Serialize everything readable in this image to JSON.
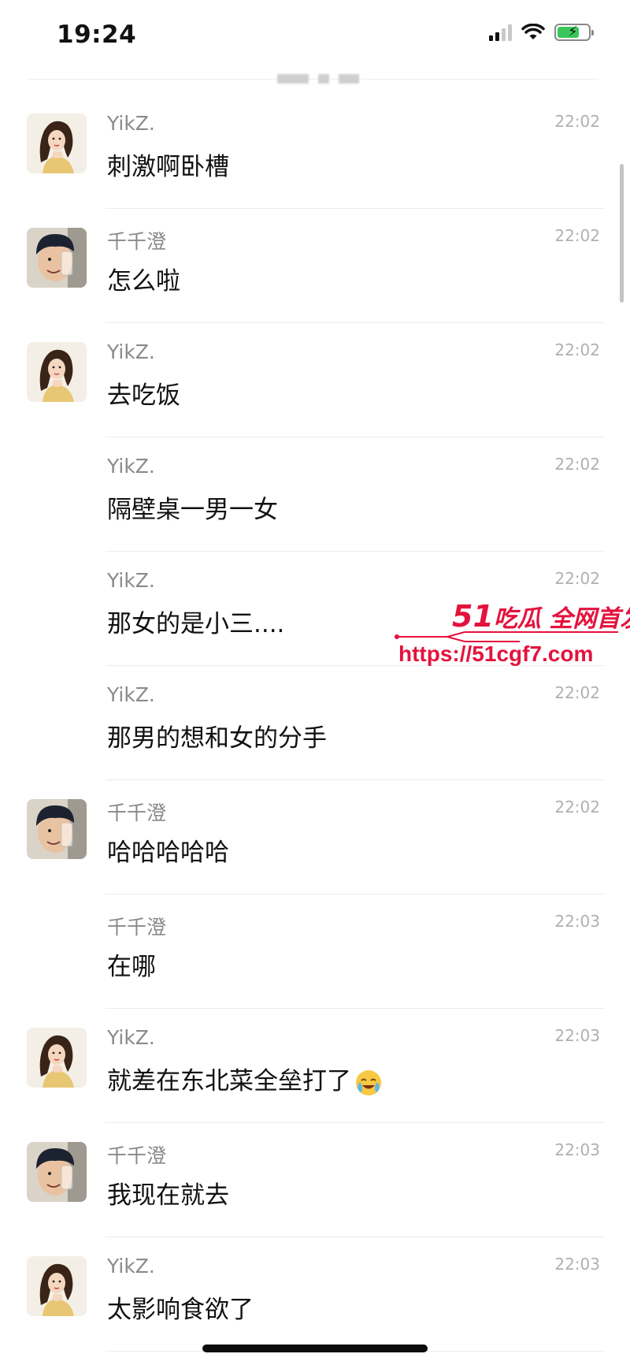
{
  "status_bar": {
    "time": "19:24",
    "battery_level": 0.7
  },
  "messages": [
    {
      "sender": "YikZ.",
      "avatar": "belle-avatar",
      "show_avatar": true,
      "time": "22:02",
      "text": "刺激啊卧槽"
    },
    {
      "sender": "千千澄",
      "avatar": "man-avatar",
      "show_avatar": true,
      "time": "22:02",
      "text": "怎么啦"
    },
    {
      "sender": "YikZ.",
      "avatar": "belle-avatar",
      "show_avatar": true,
      "time": "22:02",
      "text": "去吃饭"
    },
    {
      "sender": "YikZ.",
      "avatar": "belle-avatar",
      "show_avatar": false,
      "time": "22:02",
      "text": "隔壁桌一男一女"
    },
    {
      "sender": "YikZ.",
      "avatar": "belle-avatar",
      "show_avatar": false,
      "time": "22:02",
      "text": "那女的是小三...."
    },
    {
      "sender": "YikZ.",
      "avatar": "belle-avatar",
      "show_avatar": false,
      "time": "22:02",
      "text": "那男的想和女的分手"
    },
    {
      "sender": "千千澄",
      "avatar": "man-avatar",
      "show_avatar": true,
      "time": "22:02",
      "text": "哈哈哈哈哈"
    },
    {
      "sender": "千千澄",
      "avatar": "man-avatar",
      "show_avatar": false,
      "time": "22:03",
      "text": "在哪"
    },
    {
      "sender": "YikZ.",
      "avatar": "belle-avatar",
      "show_avatar": true,
      "time": "22:03",
      "text": "就差在东北菜全垒打了",
      "emoji": "crying-laughing-emoji"
    },
    {
      "sender": "千千澄",
      "avatar": "man-avatar",
      "show_avatar": true,
      "time": "22:03",
      "text": "我现在就去"
    },
    {
      "sender": "YikZ.",
      "avatar": "belle-avatar",
      "show_avatar": true,
      "time": "22:03",
      "text": "太影响食欲了"
    }
  ],
  "watermark": {
    "brand_number": "51",
    "brand_text": "吃瓜 全网首发",
    "url": "https://51cgf7.com",
    "color": "#e4133d"
  }
}
